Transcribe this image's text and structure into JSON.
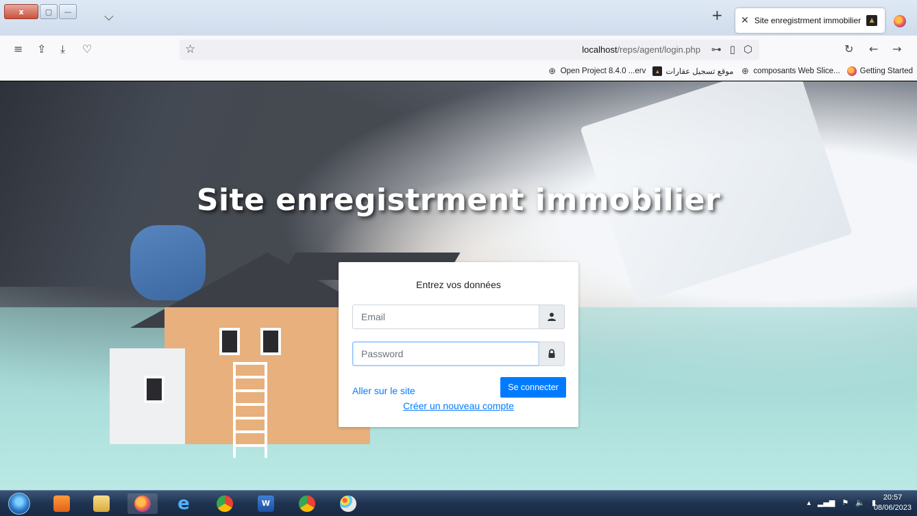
{
  "browser": {
    "window_buttons": {
      "close": "x",
      "restore": "▢",
      "minimize": "—"
    },
    "tab": {
      "title": "Site enregistrment immobilier",
      "favicon": "house-favicon"
    },
    "url": {
      "host": "localhost",
      "path": "/reps/agent/login.php"
    },
    "bookmarks": [
      {
        "label": "Getting Started",
        "icon": "firefox-icon"
      },
      {
        "label": "composants Web Slice...",
        "icon": "globe-icon"
      },
      {
        "label": "موقع تسجيل عقارات",
        "icon": "house-favicon"
      },
      {
        "label": "Open Project 8.4.0 ...erv",
        "icon": "globe-icon"
      }
    ]
  },
  "page": {
    "title": "Site enregistrment immobilier",
    "login": {
      "heading": "Entrez vos données",
      "email_placeholder": "Email",
      "password_placeholder": "Password",
      "submit_label": "Se connecter",
      "site_link": "Aller sur le site",
      "register_link": "Créer un nouveau compte"
    }
  },
  "taskbar": {
    "apps": [
      "media-player-icon",
      "file-explorer-icon",
      "firefox-icon",
      "internet-explorer-icon",
      "chrome-icon",
      "word-icon",
      "chrome-alt-icon",
      "paint-icon"
    ],
    "clock": {
      "time": "20:57",
      "date": "08/06/2023"
    }
  },
  "colors": {
    "accent": "#007bff",
    "taskbar": "#1f3350"
  }
}
